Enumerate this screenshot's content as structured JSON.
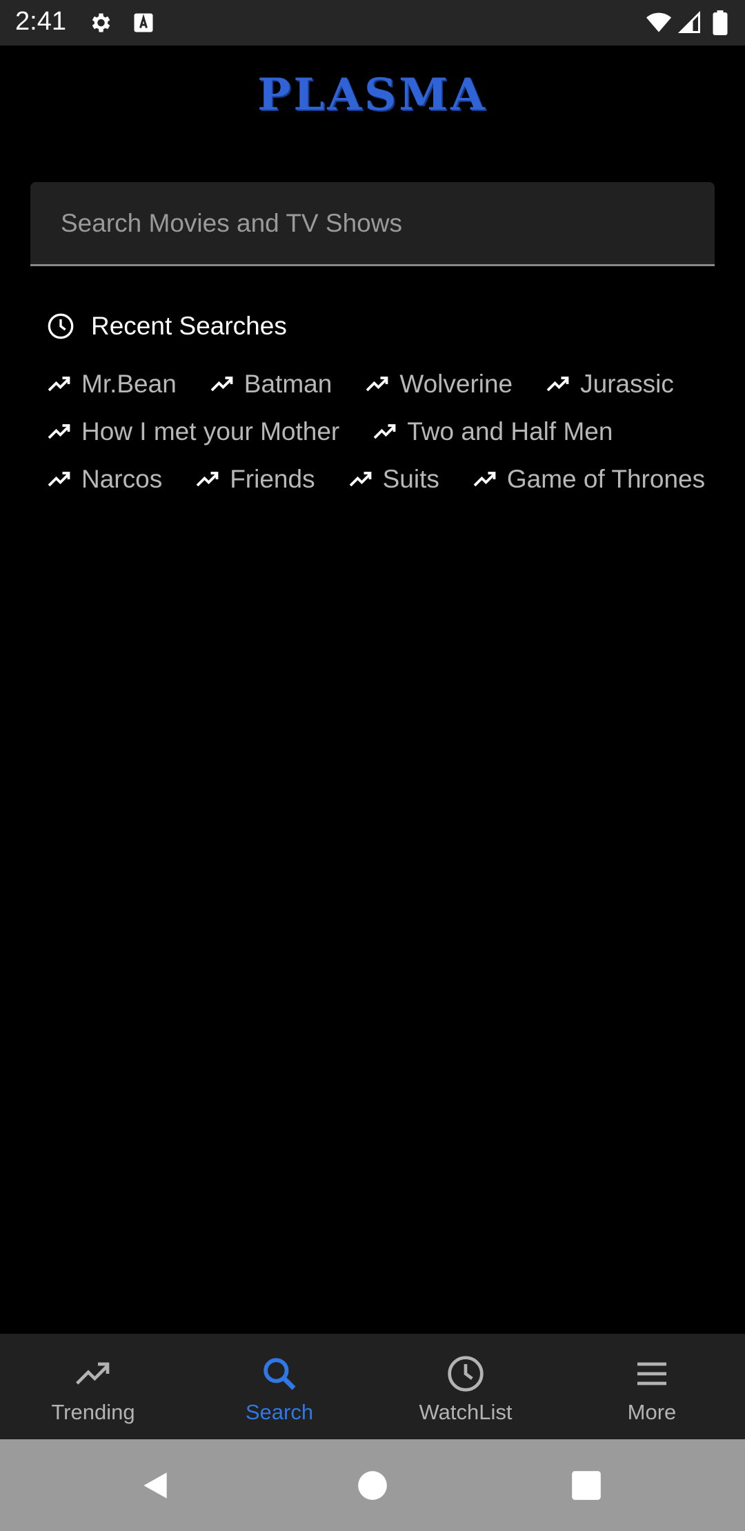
{
  "status_bar": {
    "time": "2:41",
    "icons": [
      "gear-icon",
      "a-keyboard-icon",
      "wifi-icon",
      "signal-icon",
      "battery-icon"
    ]
  },
  "app": {
    "title": "PLASMA",
    "accent_color": "#2f63d6"
  },
  "search": {
    "placeholder": "Search Movies and TV Shows",
    "value": ""
  },
  "recent": {
    "title": "Recent Searches",
    "rows": [
      [
        "Mr.Bean",
        "Batman",
        "Wolverine",
        "Jurassic"
      ],
      [
        "How I met your Mother",
        "Two and Half Men"
      ],
      [
        "Narcos",
        "Friends",
        "Suits",
        "Game of Thrones"
      ]
    ]
  },
  "bottom_nav": {
    "items": [
      {
        "label": "Trending",
        "icon": "trending-icon",
        "active": false
      },
      {
        "label": "Search",
        "icon": "search-icon",
        "active": true
      },
      {
        "label": "WatchList",
        "icon": "clock-icon",
        "active": false
      },
      {
        "label": "More",
        "icon": "menu-icon",
        "active": false
      }
    ],
    "active_color": "#2f78e6"
  },
  "system_nav": [
    "back-icon",
    "home-icon",
    "recents-icon"
  ]
}
